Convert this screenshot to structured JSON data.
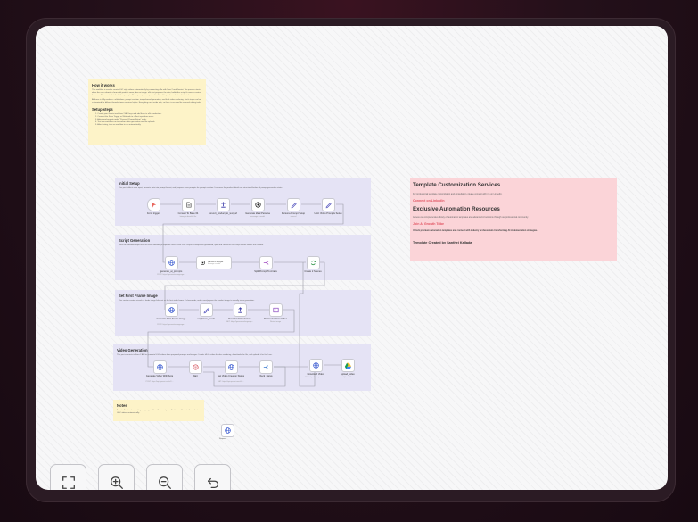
{
  "how_it_works": {
    "title": "How it works",
    "body1": "This workflow is used to create UGC style videos automatically by connecting n8n with Sora 2 and Gemini. The process starts when the user submits a form with product name, idea or image. n8n first prepares the data, builds the script & camera context, then uses AI to create detailed video prompts. These prompts are passed to Sora 2 to produce short realistic videos.",
    "body2": "All these is fully modular - while ideas, prompt creation, image-based generation, and final video rendering. Each stage can be customized for different brands, tones or visual styles. Everything runs inside n8n, so there is no need for external editing tools.",
    "setup_title": "Setup steps",
    "steps": [
      "1. Create your Gemini and Sora 2 API keys and add them to n8n credentials.",
      "2. Connect the Form Trigger or Webhook to collect input from users.",
      "3. Adjust and prompt nodes \"Personal Prompt Setup\" node.",
      "4. Test one workflow run to confirm video generation and file uploads.",
      "5. After testing, turn on workflow to run automatically."
    ]
  },
  "sections": {
    "initial": {
      "title": "Initial Setup",
      "desc": "This part collects user input, converts data into prompt format, and prepares base prompts for prompt creation. It ensures the product details are structured before AI prompt generation starts."
    },
    "script": {
      "title": "Script Generation",
      "desc": "Uses the workflow output of AI to create detailed prompts for Sora scene UGC scripts. Prompts are generated, split, and sorted for next steps before videos are created."
    },
    "frame": {
      "title": "Set First Frame Image",
      "desc": "This section creates visuals or loads image links set as the first video frame. If chosen/ads, make sure/prepare the product image to visually video generation."
    },
    "video": {
      "title": "Video Generation",
      "desc": "This part connects to Sora 2 API to generate UGC videos from prepared prompts and images. It waits till the video finishes rendering, downloads the file, and uploads it for final use."
    }
  },
  "nodes": {
    "form_trigger": {
      "label": "Form trigger"
    },
    "convert_base64": {
      "label": "Convert To Base 64",
      "sub": "binary to base64: file"
    },
    "convert_product": {
      "label": "convert_product_to_text_url"
    },
    "generate_ideal": {
      "label": "Generate Ideal Persona",
      "sub": "message a model"
    },
    "persona_setup": {
      "label": "Persona Prompt Setup",
      "sub": "manual"
    },
    "ugc_prompts": {
      "label": "UGC Video Prompts Setup",
      "sub": "manual"
    },
    "generate_ai_prompts": {
      "label": "generate_ai_prompts",
      "sub": "POST: https://generativelanguage..."
    },
    "gemini_prompts": {
      "label": "Gemini Prompts",
      "sub": "Message a model"
    },
    "split_prompt": {
      "label": "Split Prompt To Arrays"
    },
    "create_scenes": {
      "label": "Create 2 Scenes"
    },
    "generate_first_frame": {
      "label": "Generate First Frame Image",
      "sub": "POST: https://generativelanguage..."
    },
    "set_frame": {
      "label": "set_frame_result"
    },
    "download_first_frame": {
      "label": "Download First Frame",
      "sub": "GET: https://generativelanguage..."
    },
    "resize_image": {
      "label": "Resize For Sora Video",
      "sub": "Resize image"
    },
    "generate_video": {
      "label": "Generate Video With Sora",
      "sub": "POST: https://api.openai.com/v1/..."
    },
    "wait": {
      "label": "Wait"
    },
    "get_status": {
      "label": "Get Video Creation Status",
      "sub": "GET: https://api.openai.com/v1/..."
    },
    "check_status": {
      "label": "check_status"
    },
    "download_video": {
      "label": "Download Video",
      "sub": "GET: https://api.openai.com"
    },
    "upload_video": {
      "label": "upload_video",
      "sub": "Upload: file"
    },
    "orphan": {
      "label": "Respond"
    }
  },
  "notes": {
    "title": "Notes",
    "body": "Adjust all instructions or keys as per your Sora 2 account plan. Each run will create three short UGC videos automatically."
  },
  "template": {
    "h1": "Template Customization Services",
    "p1": "For professional template customization and consultation, please connect with me on LinkedIn.",
    "link1": "Connect on LinkedIn",
    "h2": "Exclusive Automation Resources",
    "p2": "Access our comprehensive library of automation templates and advanced AI solutions through our professional community.",
    "link2": "Join AI Growth Tribe",
    "p3": "Unlock premium automation templates and connect with industry professionals transforming AI implementation strategies.",
    "credit": "Template Created by Santhej Kallada"
  },
  "controls": {
    "fit": "fit-view-icon",
    "zoom_in": "zoom-in-icon",
    "zoom_out": "zoom-out-icon",
    "undo": "undo-icon"
  }
}
